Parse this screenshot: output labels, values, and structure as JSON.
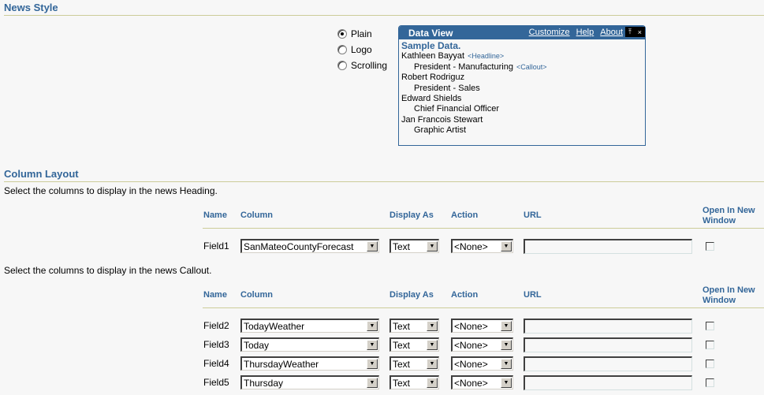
{
  "news_style": {
    "title": "News Style",
    "options": [
      {
        "label": "Plain",
        "checked": true
      },
      {
        "label": "Logo",
        "checked": false
      },
      {
        "label": "Scrolling",
        "checked": false
      }
    ],
    "data_view": {
      "title": "Data View",
      "links": [
        "Customize",
        "Help",
        "About"
      ],
      "controls": {
        "pin_icon": "⤒",
        "close_icon": "×"
      },
      "sample_title": "Sample Data.",
      "entries": [
        {
          "text": "Kathleen Bayyat",
          "indent": false,
          "tag": "<Headline>"
        },
        {
          "text": "President - Manufacturing",
          "indent": true,
          "tag": "<Callout>"
        },
        {
          "text": "Robert Rodriguz",
          "indent": false,
          "tag": ""
        },
        {
          "text": "President - Sales",
          "indent": true,
          "tag": ""
        },
        {
          "text": "Edward Shields",
          "indent": false,
          "tag": ""
        },
        {
          "text": "Chief Financial Officer",
          "indent": true,
          "tag": ""
        },
        {
          "text": "Jan Francois Stewart",
          "indent": false,
          "tag": ""
        },
        {
          "text": "Graphic Artist",
          "indent": true,
          "tag": ""
        }
      ]
    }
  },
  "column_layout": {
    "title": "Column Layout",
    "heading_instruction": "Select the columns to display in the news Heading.",
    "callout_instruction": "Select the columns to display in the news Callout.",
    "headers": {
      "name": "Name",
      "column": "Column",
      "display_as": "Display As",
      "action": "Action",
      "url": "URL",
      "open_new_line1": "Open In New",
      "open_new_line2": "Window"
    },
    "heading_rows": [
      {
        "name": "Field1",
        "column": "SanMateoCountyForecast",
        "display_as": "Text",
        "action": "<None>",
        "url": "",
        "open_new": false
      }
    ],
    "callout_rows": [
      {
        "name": "Field2",
        "column": "TodayWeather",
        "display_as": "Text",
        "action": "<None>",
        "url": "",
        "open_new": false
      },
      {
        "name": "Field3",
        "column": "Today",
        "display_as": "Text",
        "action": "<None>",
        "url": "",
        "open_new": false
      },
      {
        "name": "Field4",
        "column": "ThursdayWeather",
        "display_as": "Text",
        "action": "<None>",
        "url": "",
        "open_new": false
      },
      {
        "name": "Field5",
        "column": "Thursday",
        "display_as": "Text",
        "action": "<None>",
        "url": "",
        "open_new": false
      }
    ]
  }
}
